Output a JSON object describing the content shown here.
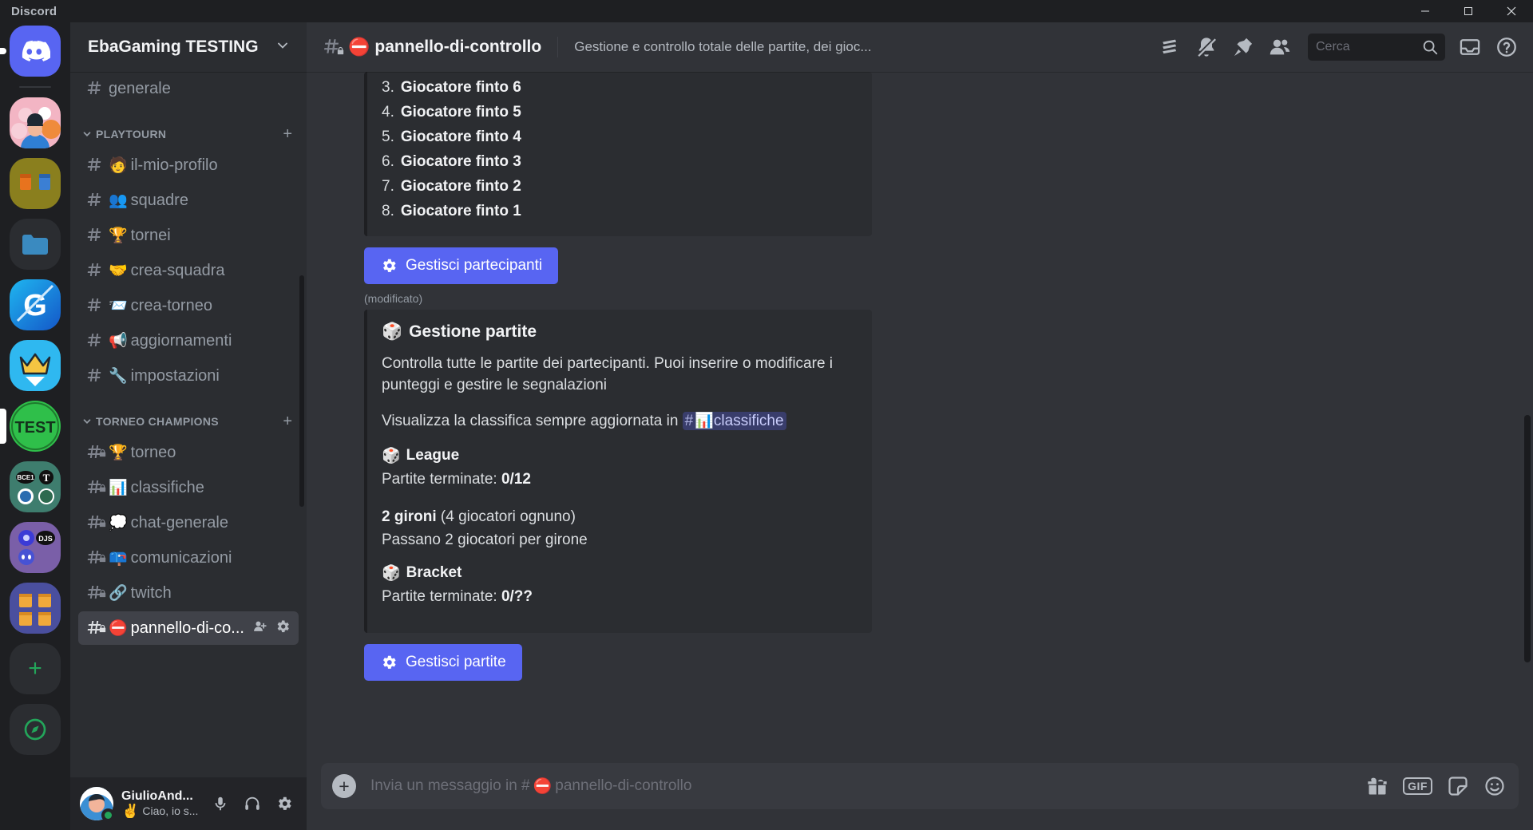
{
  "titlebar": {
    "app_name": "Discord",
    "minimize": "minimize-icon",
    "maximize": "maximize-icon",
    "close": "close-icon"
  },
  "rail": {
    "items": [
      {
        "name": "home",
        "label": "Discord",
        "type": "home"
      },
      {
        "name": "server-friends",
        "label": "",
        "type": "image",
        "color": "#f0a0b0"
      },
      {
        "name": "server-olive",
        "label": "",
        "type": "image",
        "color": "#8a7f1e"
      },
      {
        "name": "server-folder",
        "label": "",
        "type": "folder",
        "color": "#3a8ac0"
      },
      {
        "name": "server-g",
        "label": "G",
        "type": "image",
        "color": "#1a9fe0"
      },
      {
        "name": "server-crown",
        "label": "",
        "type": "image",
        "color": "#2fb8f0"
      },
      {
        "name": "server-test",
        "label": "TEST",
        "type": "image",
        "color": "#2fbf4a",
        "selected": true
      },
      {
        "name": "server-bce1",
        "label": "",
        "type": "image",
        "color": "#3e7d6e"
      },
      {
        "name": "server-djs",
        "label": "",
        "type": "image",
        "color": "#7a5fa8"
      },
      {
        "name": "server-gift",
        "label": "",
        "type": "image",
        "color": "#4a4f9e"
      },
      {
        "name": "add-server",
        "label": "+",
        "type": "add"
      },
      {
        "name": "explore-servers",
        "label": "",
        "type": "explore"
      }
    ]
  },
  "sidebar": {
    "guild_name": "EbaGaming TESTING",
    "groups": [
      {
        "name": "",
        "collapsible": false,
        "channels": [
          {
            "label": "generale",
            "emoji": "",
            "locked": false,
            "active": false
          }
        ]
      },
      {
        "name": "PLAYTOURN",
        "collapsible": true,
        "channels": [
          {
            "label": "il-mio-profilo",
            "emoji": "🧑",
            "locked": false,
            "active": false
          },
          {
            "label": "squadre",
            "emoji": "👥",
            "locked": false,
            "active": false
          },
          {
            "label": "tornei",
            "emoji": "🏆",
            "locked": false,
            "active": false
          },
          {
            "label": "crea-squadra",
            "emoji": "🤝",
            "locked": false,
            "active": false
          },
          {
            "label": "crea-torneo",
            "emoji": "📨",
            "locked": false,
            "active": false
          },
          {
            "label": "aggiornamenti",
            "emoji": "📢",
            "locked": false,
            "active": false
          },
          {
            "label": "impostazioni",
            "emoji": "🔧",
            "locked": false,
            "active": false
          }
        ]
      },
      {
        "name": "TORNEO CHAMPIONS",
        "collapsible": true,
        "channels": [
          {
            "label": "torneo",
            "emoji": "🏆",
            "locked": true,
            "active": false
          },
          {
            "label": "classifiche",
            "emoji": "📊",
            "locked": true,
            "active": false
          },
          {
            "label": "chat-generale",
            "emoji": "💭",
            "locked": true,
            "active": false
          },
          {
            "label": "comunicazioni",
            "emoji": "📪",
            "locked": true,
            "active": false
          },
          {
            "label": "twitch",
            "emoji": "🔗",
            "locked": true,
            "active": false
          },
          {
            "label": "pannello-di-co...",
            "emoji": "⛔",
            "locked": true,
            "active": true
          }
        ]
      }
    ]
  },
  "user_panel": {
    "username": "GiulioAnd...",
    "status_emoji": "✌️",
    "status_text": "Ciao, io s...",
    "buttons": [
      {
        "name": "mute-microphone-button",
        "icon": "microphone-icon"
      },
      {
        "name": "deafen-button",
        "icon": "headphones-icon"
      },
      {
        "name": "user-settings-button",
        "icon": "gear-icon"
      }
    ]
  },
  "channel_header": {
    "channel_name": "pannello-di-controllo",
    "channel_emoji": "⛔",
    "locked": true,
    "topic": "Gestione e controllo totale delle partite, dei gioc...",
    "actions": [
      {
        "name": "threads-button",
        "icon": "threads-icon"
      },
      {
        "name": "notification-settings-button",
        "icon": "bell-muted-icon"
      },
      {
        "name": "pinned-messages-button",
        "icon": "pin-icon"
      },
      {
        "name": "member-list-button",
        "icon": "members-icon"
      }
    ],
    "trailing_actions": [
      {
        "name": "inbox-button",
        "icon": "inbox-icon"
      },
      {
        "name": "help-button",
        "icon": "help-icon"
      }
    ]
  },
  "search": {
    "placeholder": "Cerca",
    "value": "",
    "icon": "search-icon"
  },
  "messages": {
    "participants_embed": {
      "list": [
        {
          "num": "3.",
          "name": "Giocatore finto 6"
        },
        {
          "num": "4.",
          "name": "Giocatore finto 5"
        },
        {
          "num": "5.",
          "name": "Giocatore finto 4"
        },
        {
          "num": "6.",
          "name": "Giocatore finto 3"
        },
        {
          "num": "7.",
          "name": "Giocatore finto 2"
        },
        {
          "num": "8.",
          "name": "Giocatore finto 1"
        }
      ]
    },
    "manage_participants_button": {
      "label": "Gestisci partecipanti",
      "icon": "gear-icon"
    },
    "edited_label": "(modificato)",
    "matches_embed": {
      "title": "Gestione partite",
      "title_emoji": "🎲",
      "paragraph1": "Controlla tutte le partite dei partecipanti. Puoi inserire o modificare i punteggi e gestire le segnalazioni",
      "paragraph2_prefix": "Visualizza la classifica sempre aggiornata in",
      "mention_hash": "#",
      "mention_emoji": "📊",
      "mention_label": "classifiche",
      "sections": [
        {
          "emoji": "🎲",
          "heading": "League",
          "lines": [
            {
              "text": "Partite terminate: ",
              "bold": "0/12"
            }
          ],
          "extra": [
            {
              "bold": "2 gironi",
              "text": " (4 giocatori ognuno)"
            },
            {
              "text": "Passano 2 giocatori per girone"
            }
          ]
        },
        {
          "emoji": "🎲",
          "heading": "Bracket",
          "lines": [
            {
              "text": "Partite terminate: ",
              "bold": "0/??"
            }
          ],
          "extra": []
        }
      ]
    },
    "manage_matches_button": {
      "label": "Gestisci partite",
      "icon": "gear-icon"
    }
  },
  "composer": {
    "placeholder_prefix": "Invia un messaggio in #",
    "placeholder_emoji": "⛔",
    "placeholder_channel": "pannello-di-controllo",
    "value": "",
    "add_button": "+",
    "actions": [
      {
        "name": "gift-button",
        "icon": "gift-icon"
      },
      {
        "name": "gif-button",
        "icon": "gif-icon",
        "label": "GIF"
      },
      {
        "name": "sticker-button",
        "icon": "sticker-icon"
      },
      {
        "name": "emoji-button",
        "icon": "emoji-icon"
      }
    ]
  },
  "colors": {
    "brand": "#5865f2",
    "sidebar_bg": "#2b2d31",
    "main_bg": "#313338",
    "rail_bg": "#1e1f22",
    "online": "#23a55a",
    "danger": "#ed4245"
  }
}
